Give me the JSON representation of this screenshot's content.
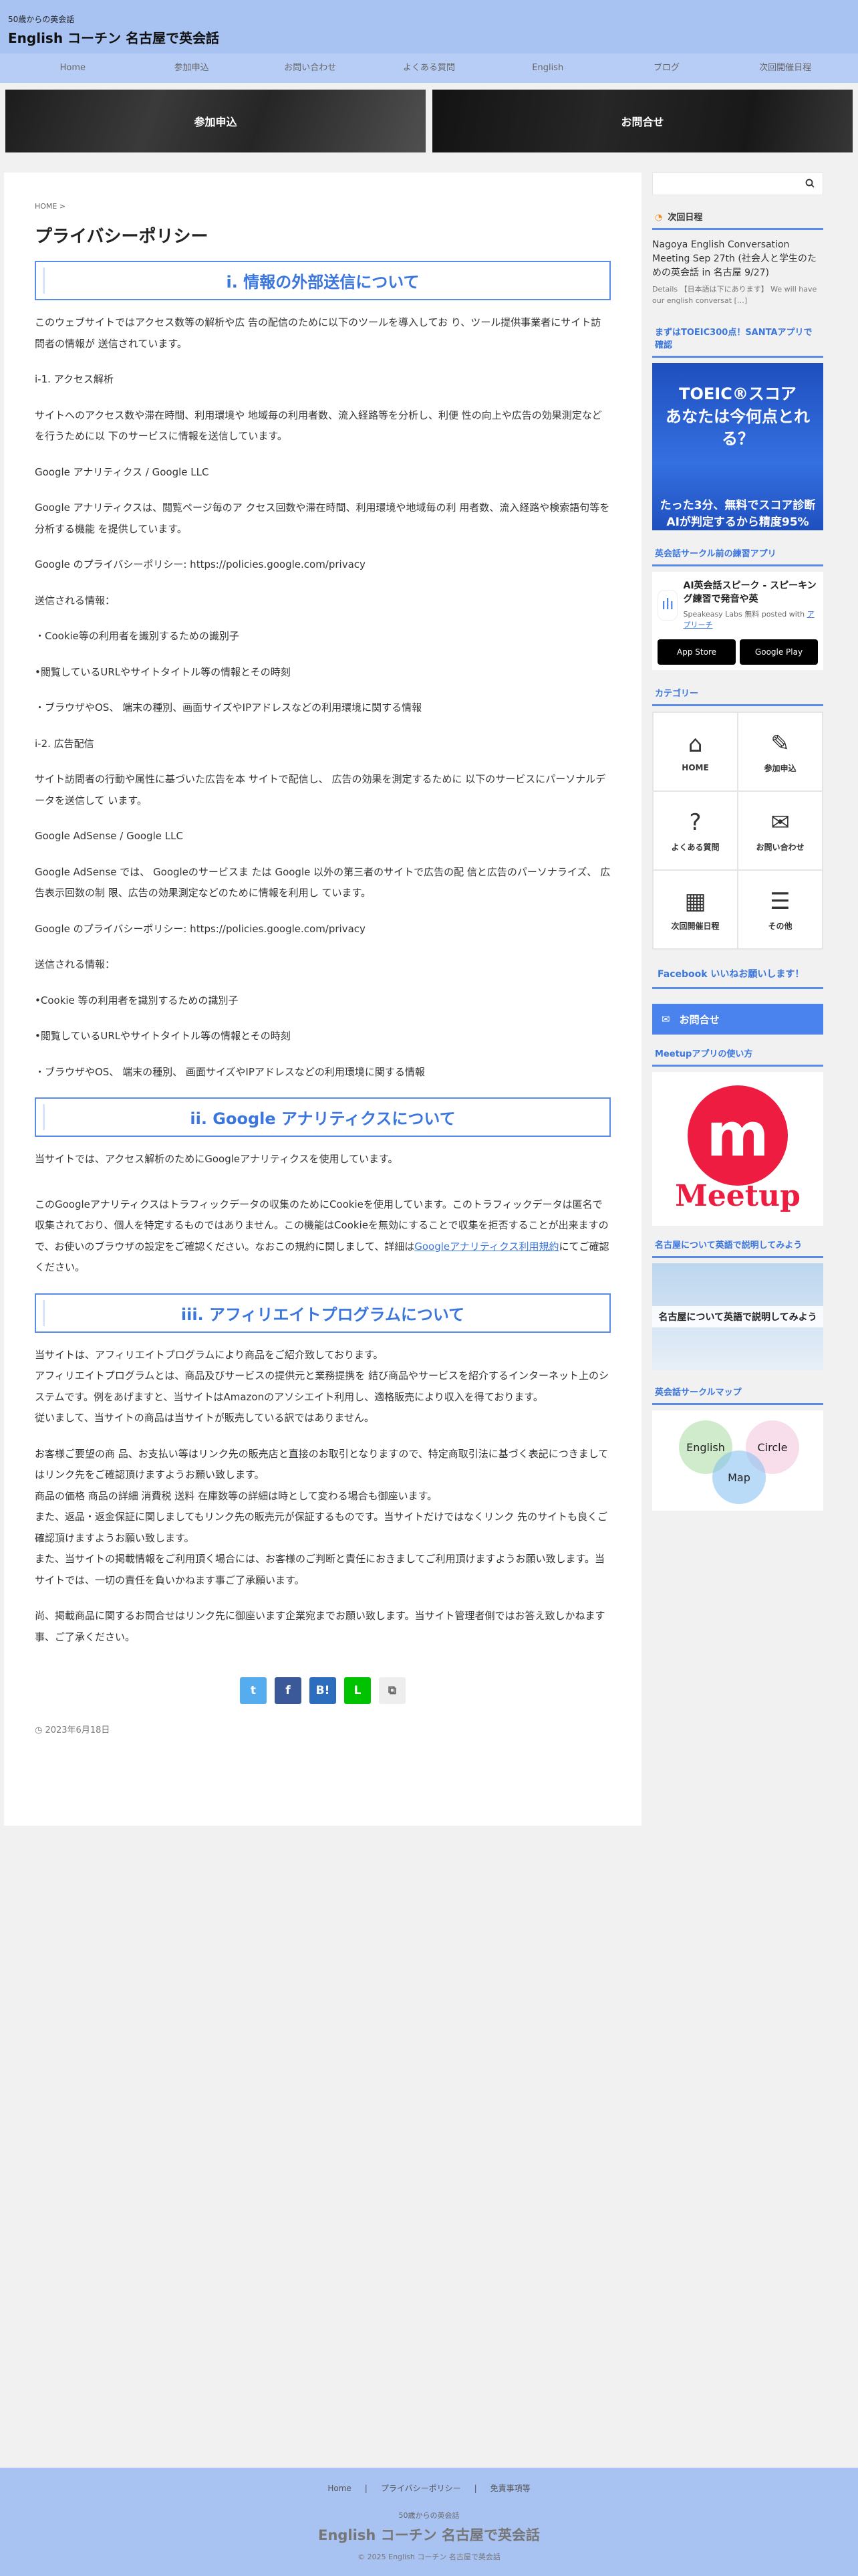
{
  "header": {
    "tagline": "50歳からの英会話",
    "title": "English コーチン 名古屋で英会話"
  },
  "nav": [
    "Home",
    "参加申込",
    "お問い合わせ",
    "よくある質問",
    "English",
    "ブログ",
    "次回開催日程"
  ],
  "banners": {
    "left": "参加申込",
    "right": "お問合せ"
  },
  "main": {
    "breadcrumb": "HOME >",
    "page_title": "プライバシーポリシー",
    "sections": [
      "i. 情報の外部送信について",
      "ii. Google アナリティクスについて",
      "iii. アフィリエイトプログラムについて"
    ],
    "sec1_paras": [
      "このウェブサイトではアクセス数等の解析や広 告の配信のために以下のツールを導入してお り、ツール提供事業者にサイト訪問者の情報が 送信されています。",
      "i-1. アクセス解析",
      "サイトへのアクセス数や滞在時間、利用環境や 地域毎の利用者数、流入経路等を分析し、利便 性の向上や広告の効果測定などを行うために以 下のサービスに情報を送信しています。",
      "Google アナリティクス / Google LLC",
      "Google アナリティクスは、閲覧ページ毎のア クセス回数や滞在時間、利用環境や地域毎の利 用者数、流入経路や検索語句等を分析する機能 を提供しています。",
      "Google のプライバシーポリシー: https://policies.google.com/privacy",
      "送信される情報：",
      "・Cookie等の利用者を識別するための識別子",
      "•閲覧しているURLやサイトタイトル等の情報とその時刻",
      "・ブラウザやOS、 端末の種別、画面サイズやIPアドレスなどの利用環境に関する情報",
      "i-2. 広告配信",
      "サイト訪問者の行動や属性に基づいた広告を本 サイトで配信し、 広告の効果を測定するために 以下のサービスにパーソナルデータを送信して います。",
      "Google AdSense / Google LLC",
      "Google AdSense では、 Googleのサービスま たは Google 以外の第三者のサイトで広告の配 信と広告のパーソナライズ、 広告表示回数の制 限、広告の効果測定などのために情報を利用し ています。",
      "Google のプライバシーポリシー: https://policies.google.com/privacy",
      "送信される情報：",
      "•Cookie 等の利用者を識別するための識別子",
      "•閲覧しているURLやサイトタイトル等の情報とその時刻",
      "・ブラウザやOS、 端末の種別、 画面サイズやIPアドレスなどの利用環境に関する情報"
    ],
    "sec2_p1": "当サイトでは、アクセス解析のためにGoogleアナリティクスを使用しています。",
    "sec2_p2a": "このGoogleアナリティクスはトラフィックデータの収集のためにCookieを使用しています。このトラフィックデータは匿名で収集されており、個人を特定するものではありません。この機能はCookieを無効にすることで収集を拒否することが出来ますので、お使いのブラウザの設定をご確認ください。なおこの規約に関しまして、詳細は",
    "sec2_link": "Googleアナリティクス利用規約",
    "sec2_p2b": "にてご確認ください。",
    "sec3_block1": [
      "当サイトは、アフィリエイトプログラムにより商品をご紹介致しております。",
      "アフィリエイトプログラムとは、商品及びサービスの提供元と業務提携を 結び商品やサービスを紹介するインターネット上のシステムです。例をあげますと、当サイトはAmazonのアソシエイト利用し、適格販売により収入を得ております。",
      "従いまして、当サイトの商品は当サイトが販売している訳ではありません。"
    ],
    "sec3_block2": [
      "お客様ご要望の商 品、お支払い等はリンク先の販売店と直接のお取引となりますので、特定商取引法に基づく表記につきましてはリンク先をご確認頂けますようお願い致します。",
      "商品の価格 商品の詳細 消費税 送料 在庫数等の詳細は時として変わる場合も御座います。",
      "また、返品・返金保証に関しましてもリンク先の販売元が保証するものです。当サイトだけではなくリンク 先のサイトも良くご確認頂けますようお願い致します。",
      "また、当サイトの掲載情報をご利用頂く場合には、お客様のご判断と責任におきましてご利用頂けますようお願い致します。当サイトでは、一切の責任を負いかねます事ご了承願います。"
    ],
    "sec3_block3": "尚、掲載商品に関するお問合せはリンク先に御座います企業宛までお願い致します。当サイト管理者側ではお答え致しかねます事、ご了承ください。",
    "share": {
      "twitter": "t",
      "facebook": "f",
      "hatena": "B!",
      "line": "L",
      "copy": "⧉"
    },
    "date": "◷ 2023年6月18日"
  },
  "sidebar": {
    "next_event_title": "次回日程",
    "event_title": "Nagoya English Conversation Meeting Sep 27th (社会人と学生のための英会話 in 名古屋 9/27)",
    "event_desc": "Details 【日本語は下にあります】 We will have our english conversat […]",
    "toeic_title": "まずはTOEIC300点！SANTAアプリで確認",
    "toeic_big": "TOEIC®スコア\nあなたは今何点とれる？",
    "toeic_mid": "たった3分、無料でスコア診断\nAIが判定するから精度95%",
    "app_title": "英会話サークル前の練習アプリ",
    "app_name": "AI英会話スピーク - スピーキング練習で発音や英",
    "app_meta": "Speakeasy Labs 無料 posted with",
    "app_link": "アプリーチ",
    "store_apple": "App Store",
    "store_google": "Google Play",
    "category_title": "カテゴリー",
    "categories": [
      "HOME",
      "参加申込",
      "よくある質問",
      "お問い合わせ",
      "次回開催日程",
      "その他"
    ],
    "facebook_text": "Facebook いいねお願いします！",
    "contact_text": "お問合せ",
    "meetup_title": "Meetupアプリの使い方",
    "meetup_logo": "m",
    "meetup_text": "Meetup",
    "nagoya_title": "名古屋について英語で説明してみよう",
    "nagoya_text": "名古屋について英語で説明してみよう",
    "map_title": "英会話サークルマップ",
    "map_labels": [
      "English",
      "Circle",
      "Map"
    ]
  },
  "footer": {
    "links": [
      "Home",
      "|",
      "プライバシーポリシー",
      "|",
      "免責事項等"
    ],
    "tagline": "50歳からの英会話",
    "title": "English コーチン 名古屋で英会話",
    "copyright": "© 2025 English コーチン 名古屋で英会話"
  }
}
